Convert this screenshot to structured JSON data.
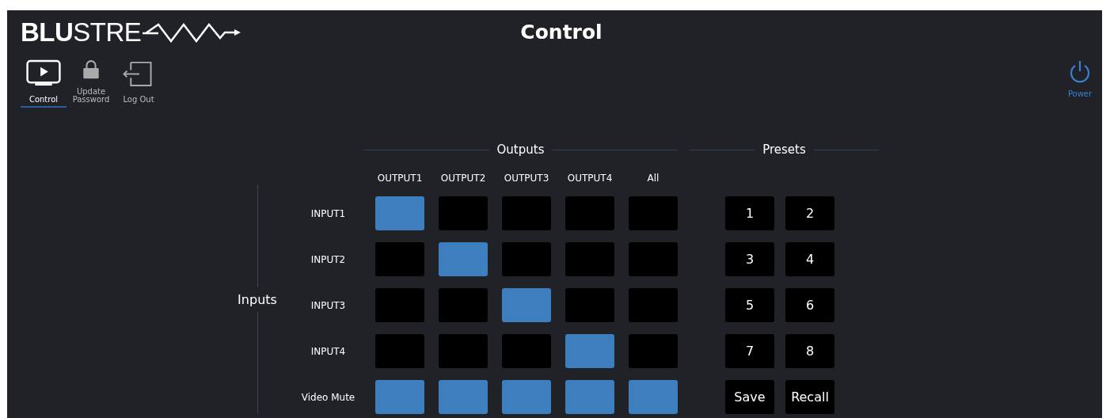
{
  "header": {
    "logo_bold": "BLU",
    "logo_light": "STRE",
    "title": "Control"
  },
  "nav": [
    {
      "label": "Control",
      "selected": true
    },
    {
      "label": "Update Password",
      "selected": false
    },
    {
      "label": "Log Out",
      "selected": false
    }
  ],
  "power": {
    "label": "Power"
  },
  "outputs_heading": "Outputs",
  "presets_heading": "Presets",
  "inputs_label": "Inputs",
  "columns": [
    "OUTPUT1",
    "OUTPUT2",
    "OUTPUT3",
    "OUTPUT4",
    "All"
  ],
  "rows": [
    {
      "label": "INPUT1",
      "cells": [
        {
          "selected": true
        },
        {
          "selected": false
        },
        {
          "selected": false
        },
        {
          "selected": false
        },
        {
          "selected": false
        }
      ]
    },
    {
      "label": "INPUT2",
      "cells": [
        {
          "selected": false
        },
        {
          "selected": true
        },
        {
          "selected": false
        },
        {
          "selected": false
        },
        {
          "selected": false
        }
      ]
    },
    {
      "label": "INPUT3",
      "cells": [
        {
          "selected": false
        },
        {
          "selected": false
        },
        {
          "selected": true
        },
        {
          "selected": false
        },
        {
          "selected": false
        }
      ]
    },
    {
      "label": "INPUT4",
      "cells": [
        {
          "selected": false
        },
        {
          "selected": false
        },
        {
          "selected": false
        },
        {
          "selected": true
        },
        {
          "selected": false
        }
      ]
    },
    {
      "label": "Video Mute",
      "cells": [
        {
          "selected": true
        },
        {
          "selected": true
        },
        {
          "selected": true
        },
        {
          "selected": true
        },
        {
          "selected": true
        }
      ]
    }
  ],
  "presets": [
    "1",
    "2",
    "3",
    "4",
    "5",
    "6",
    "7",
    "8",
    "Save",
    "Recall"
  ]
}
